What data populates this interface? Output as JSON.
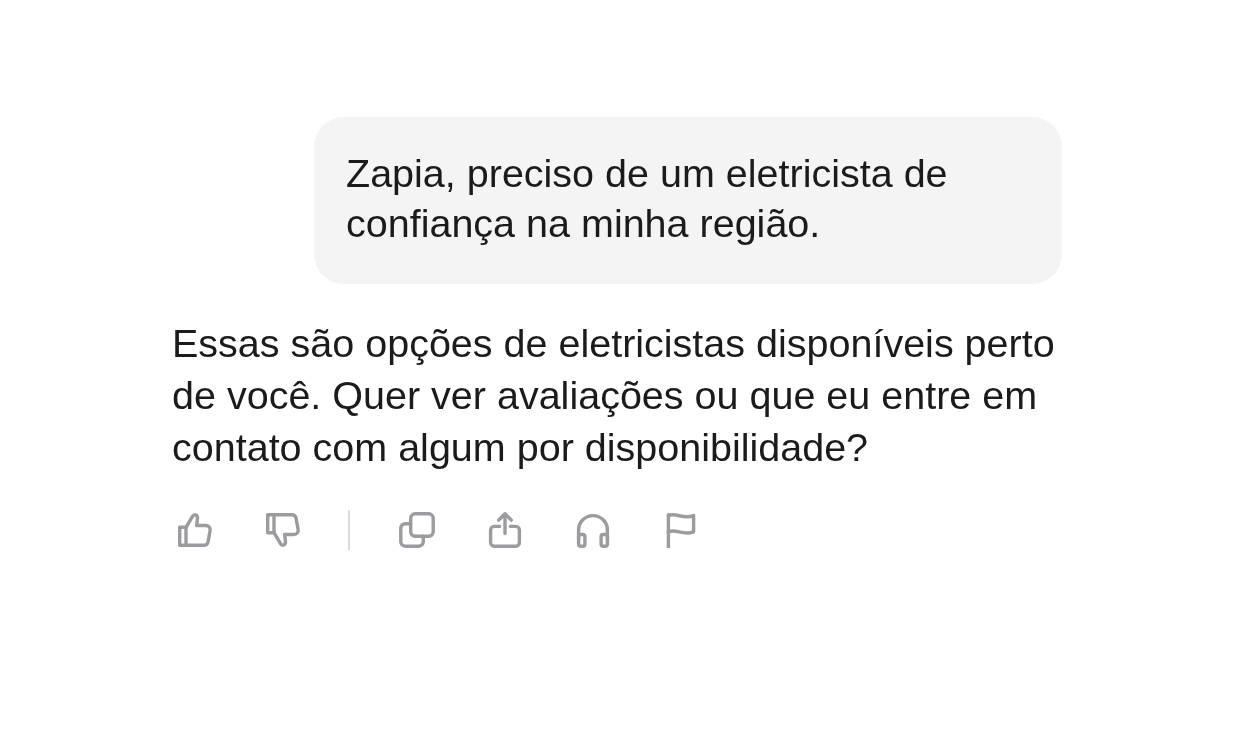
{
  "conversation": [
    {
      "kind": "user",
      "text": "Zapia, preciso de um eletricista de confiança na minha região."
    },
    {
      "kind": "assistant",
      "text": "Essas são opções de eletricistas disponíveis perto de você. Quer ver avaliações ou que eu entre em contato com algum por disponibilidade?"
    }
  ]
}
